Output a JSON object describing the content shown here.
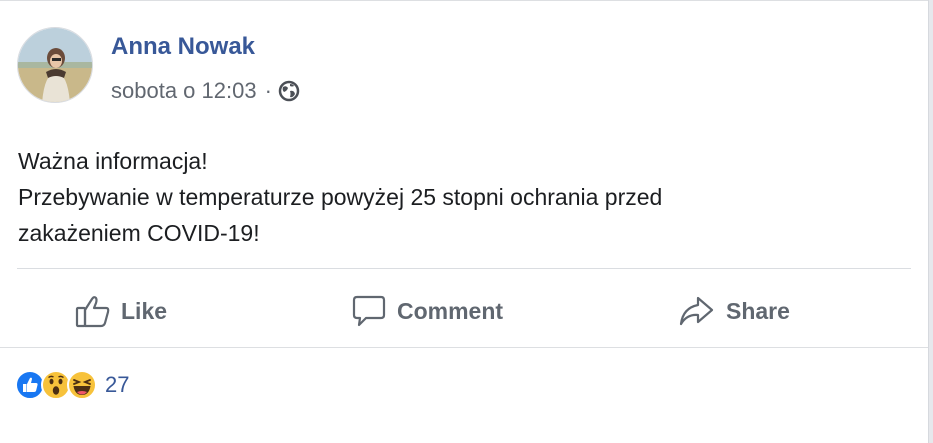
{
  "post": {
    "author": "Anna Nowak",
    "timestamp": "sobota o 12:03",
    "separator": "·",
    "privacy_icon": "globe-icon",
    "text_lines": [
      "Ważna informacja!",
      "Przebywanie w temperaturze powyżej 25 stopni ochrania przed",
      "zakażeniem COVID-19!"
    ]
  },
  "actions": {
    "like": "Like",
    "comment": "Comment",
    "share": "Share"
  },
  "reactions": {
    "icons": [
      "like-reaction-icon",
      "wow-reaction-icon",
      "haha-reaction-icon"
    ],
    "count": "27"
  },
  "colors": {
    "author_name": "#385898",
    "meta_text": "#616770",
    "action_text": "#606770",
    "like_blue": "#1877f2",
    "reaction_yellow": "#f7c23b"
  }
}
